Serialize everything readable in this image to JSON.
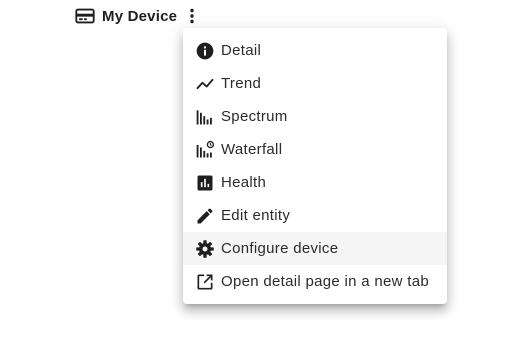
{
  "header": {
    "title": "My Device",
    "icon": "device-card-icon",
    "menu_icon": "more-vertical-icon"
  },
  "menu": {
    "highlighted": "Configure device",
    "items": [
      {
        "label": "Detail",
        "icon": "info-icon"
      },
      {
        "label": "Trend",
        "icon": "trend-icon"
      },
      {
        "label": "Spectrum",
        "icon": "spectrum-icon"
      },
      {
        "label": "Waterfall",
        "icon": "waterfall-icon"
      },
      {
        "label": "Health",
        "icon": "health-icon"
      },
      {
        "label": "Edit entity",
        "icon": "pencil-icon"
      },
      {
        "label": "Configure device",
        "icon": "gear-icon"
      },
      {
        "label": "Open detail page in a new tab",
        "icon": "open-in-new-icon"
      }
    ]
  },
  "colors": {
    "icon": "#1f1f1f",
    "text": "#2b2b2b",
    "menu_background": "#ffffff",
    "highlight_background": "#f5f5f5"
  }
}
